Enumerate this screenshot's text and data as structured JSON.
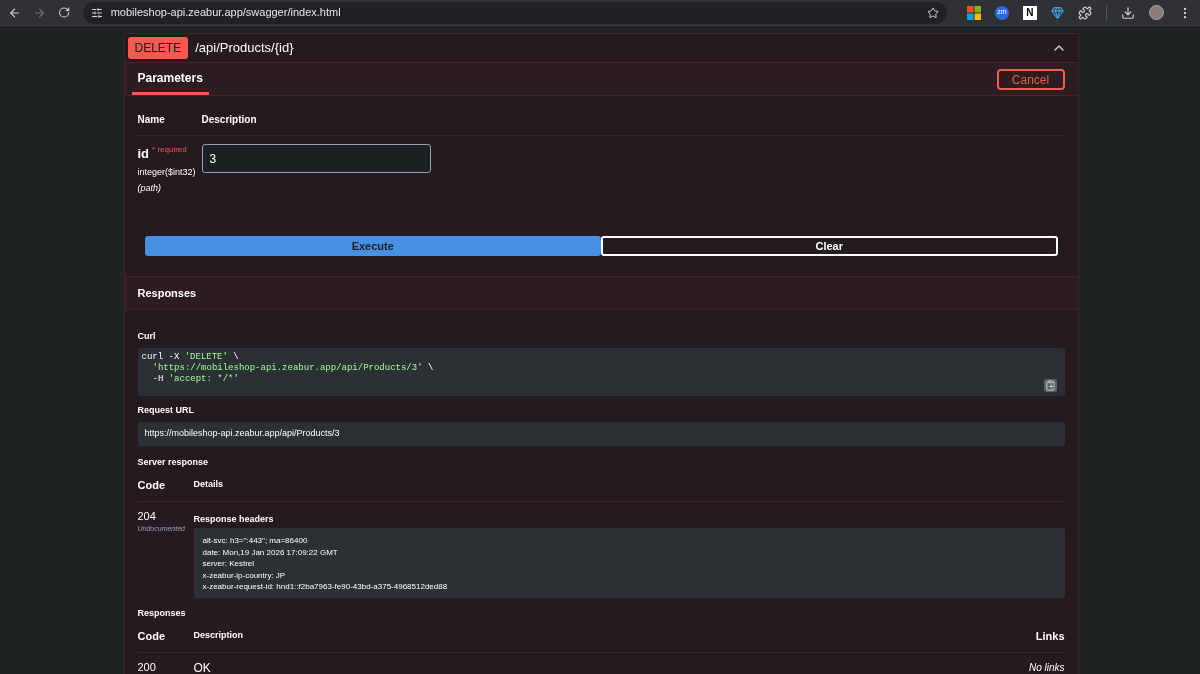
{
  "browser": {
    "url": "mobileshop-api.zeabur.app/swagger/index.html",
    "extensions": [
      {
        "kind": "windows"
      },
      {
        "kind": "badge",
        "text": "zm"
      },
      {
        "kind": "letter",
        "text": "N"
      },
      {
        "kind": "diamond"
      },
      {
        "kind": "puzzle"
      }
    ]
  },
  "operation": {
    "method": "DELETE",
    "path": "/api/Products/{id}",
    "expanded": true
  },
  "tabs": [
    {
      "label": "Parameters",
      "selected": true
    }
  ],
  "cancel_button": "Cancel",
  "parameters": {
    "columns": [
      "Name",
      "Description"
    ],
    "rows": [
      {
        "name": "id",
        "required": "* required",
        "type": "integer($int32)",
        "location": "(path)",
        "value": "3"
      }
    ]
  },
  "actions": [
    {
      "label": "Execute",
      "kind": "primary"
    },
    {
      "label": "Clear",
      "kind": "outline"
    }
  ],
  "responses_header": "Responses",
  "curl": {
    "label": "Curl",
    "lines": [
      {
        "indented": false,
        "parts": [
          {
            "text": "curl -X ",
            "kind": "plain"
          },
          {
            "text": "'DELETE'",
            "kind": "string"
          },
          {
            "text": " \\",
            "kind": "plain"
          }
        ]
      },
      {
        "indented": true,
        "parts": [
          {
            "text": "'https://mobileshop-api.zeabur.app/api/Products/3'",
            "kind": "string"
          },
          {
            "text": " \\",
            "kind": "plain"
          }
        ]
      },
      {
        "indented": true,
        "parts": [
          {
            "text": "-H ",
            "kind": "plain"
          },
          {
            "text": "'accept: */*'",
            "kind": "string"
          }
        ]
      }
    ]
  },
  "request_url": {
    "label": "Request URL",
    "value": "https://mobileshop-api.zeabur.app/api/Products/3"
  },
  "server_response": {
    "label": "Server response",
    "columns": [
      "Code",
      "Details"
    ],
    "code": "204",
    "note": "Undocumented",
    "headers_label": "Response headers",
    "headers": [
      "alt-svc: h3=\":443\"; ma=86400",
      "date: Mon,19 Jan 2026 17:09:22 GMT",
      "server: Kestrel",
      "x-zeabur-ip-country: JP",
      "x-zeabur-request-id: hnd1::f2ba7963-fe90-43bd-a375-4968512ded88"
    ]
  },
  "responses": {
    "label": "Responses",
    "columns": [
      "Code",
      "Description",
      "Links"
    ],
    "rows": [
      {
        "code": "200",
        "description": "OK",
        "links": "No links"
      }
    ]
  }
}
